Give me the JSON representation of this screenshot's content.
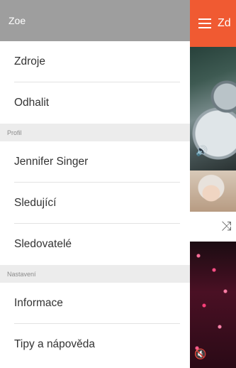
{
  "drawer": {
    "header_title": "Zoe",
    "items_top": [
      {
        "label": "Zdroje"
      },
      {
        "label": "Odhalit"
      }
    ],
    "profile_section": "Profil",
    "profile_items": [
      {
        "label": "Jennifer Singer"
      },
      {
        "label": "Sledující"
      },
      {
        "label": "Sledovatelé"
      }
    ],
    "settings_section": "Nastavení",
    "settings_items": [
      {
        "label": "Informace"
      },
      {
        "label": "Tipy a nápověda"
      }
    ]
  },
  "content": {
    "title_partial": "Zd",
    "accent_color": "#f05a32",
    "icons": [
      "menu-icon",
      "speaker-icon",
      "shuffle-icon",
      "mute-icon"
    ]
  }
}
